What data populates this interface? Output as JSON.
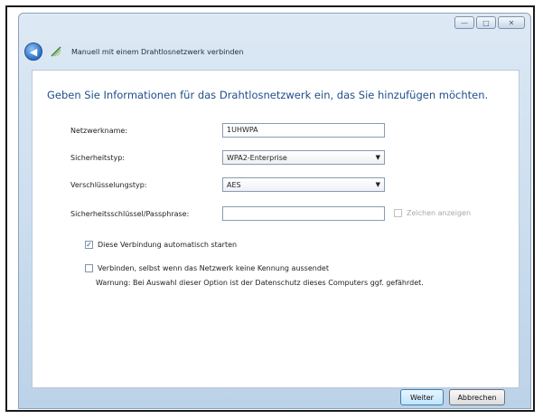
{
  "window": {
    "title": "Manuell mit einem Drahtlosnetzwerk verbinden",
    "controls": {
      "minimize": "minimize-icon",
      "maximize": "maximize-icon",
      "close": "close-icon"
    }
  },
  "nav": {
    "back_icon": "back-arrow-icon",
    "title_icon": "wireless-network-icon"
  },
  "heading": "Geben Sie Informationen für das Drahtlosnetzwerk ein, das Sie hinzufügen möchten.",
  "form": {
    "network_name_label": "Netzwerkname:",
    "network_name_value": "1UHWPA",
    "security_type_label": "Sicherheitstyp:",
    "security_type_value": "WPA2-Enterprise",
    "encryption_type_label": "Verschlüsselungstyp:",
    "encryption_type_value": "AES",
    "security_key_label": "Sicherheitsschlüssel/Passphrase:",
    "security_key_value": "",
    "show_characters_label": "Zeichen anzeigen",
    "show_characters_checked": false,
    "auto_start_label": "Diese Verbindung automatisch starten",
    "auto_start_checked": true,
    "connect_hidden_label": "Verbinden, selbst wenn das Netzwerk keine Kennung aussendet",
    "connect_hidden_checked": false,
    "warning_text": "Warnung: Bei Auswahl dieser Option ist der Datenschutz dieses Computers ggf. gefährdet."
  },
  "footer": {
    "next_label": "Weiter",
    "cancel_label": "Abbrechen"
  },
  "colors": {
    "heading": "#1f4e8c",
    "window_frame": "#c9dcee",
    "back_button": "#2a6fc4"
  }
}
